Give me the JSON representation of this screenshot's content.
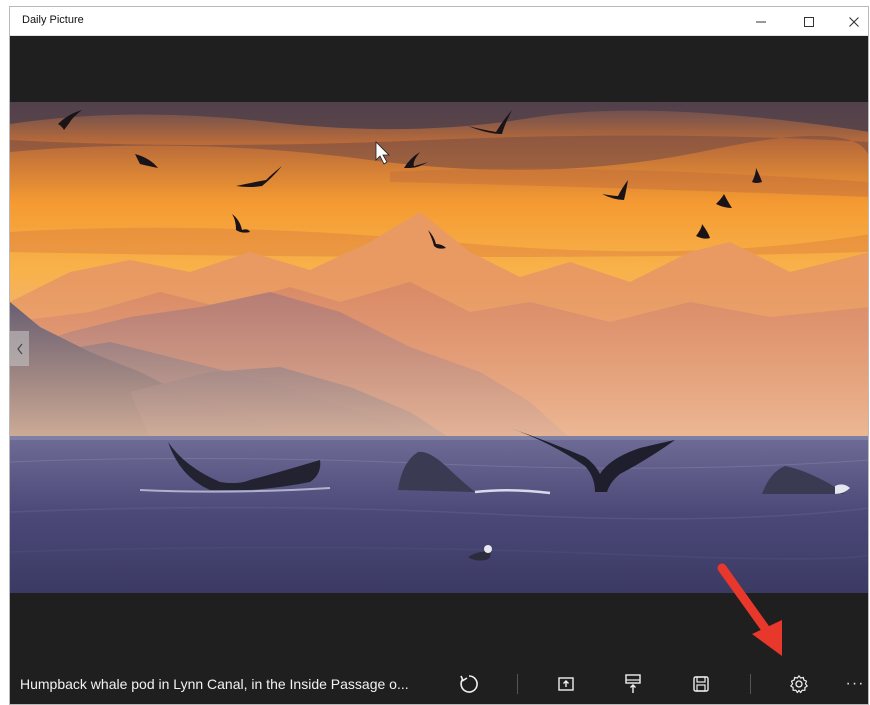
{
  "window": {
    "title": "Daily Picture",
    "controls": [
      "minimize-icon",
      "maximize-icon",
      "close-icon"
    ]
  },
  "photo": {
    "navigation": [
      "chevron-left-icon"
    ]
  },
  "commandbar": {
    "caption": "Humpback whale pod in Lynn Canal, in the Inside Passage o...",
    "buttons": [
      "refresh-icon",
      "set-lock-screen-icon",
      "set-wallpaper-icon",
      "save-icon",
      "settings-icon"
    ],
    "overflow": "···"
  },
  "colors": {
    "chrome": "#1f1f1f",
    "titlebar": "#ffffff",
    "annotation": "#e8372b"
  }
}
